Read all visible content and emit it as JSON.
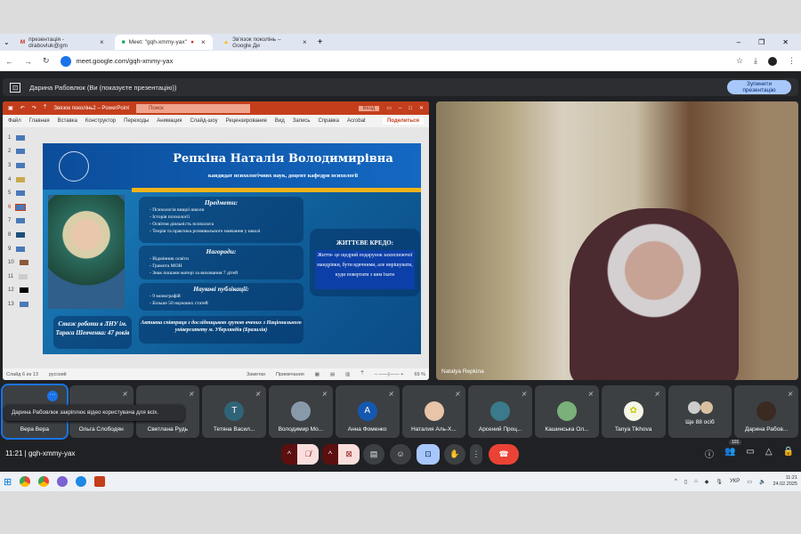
{
  "browser": {
    "tabs": [
      {
        "label": "презентація - drabovluk@gm",
        "icon": "gmail-icon"
      },
      {
        "label": "Meet: \"gqh-xmmy-yax\"",
        "icon": "meet-icon",
        "active": true
      },
      {
        "label": "Зв'язок поколінь – Google Ди",
        "icon": "drive-icon"
      }
    ],
    "new_tab": "+",
    "url": "meet.google.com/gqh-xmmy-yax"
  },
  "presenting": {
    "label": "Дарина Рабовлюк (Ви (показуєте презентацію))",
    "stop_button": "Зупинити презентацію"
  },
  "powerpoint": {
    "title": "Звязок поколінь2 – PowerPoint",
    "search_placeholder": "Поиск",
    "signin": "Вход",
    "menu": [
      "Файл",
      "Главная",
      "Вставка",
      "Конструктор",
      "Переходы",
      "Анимация",
      "Слайд-шоу",
      "Рецензирование",
      "Вид",
      "Запись",
      "Справка",
      "Acrobat"
    ],
    "share": "Поделиться",
    "slides": [
      "1",
      "2",
      "3",
      "4",
      "5",
      "6",
      "7",
      "8",
      "9",
      "10",
      "11",
      "12",
      "13"
    ],
    "selected_slide": 6,
    "status": {
      "slide": "Слайд 6 из 13",
      "language": "русский",
      "notes": "Заметки",
      "comments": "Примечания",
      "zoom": "69 %"
    }
  },
  "slide": {
    "name": "Репкіна Наталія Володимирівна",
    "subtitle": "кандидат психологічних наук, доцент кафедри психології",
    "subjects": {
      "title": "Предмети:",
      "items": [
        "Психологія вищої школи",
        "Історія психології",
        "Освітня діяльність психолога",
        "Теорія та практика розвивального навчання у школі"
      ]
    },
    "awards": {
      "title": "Нагороди:",
      "items": [
        "Відмінник освіти",
        "Грамота МОН",
        "Знак пошани матері за виховання 7 дітей"
      ]
    },
    "publications": {
      "title": "Наукові публікації:",
      "items": [
        "9 монографій",
        "Більше 50 наукових статей"
      ]
    },
    "experience": "Стаж роботи в ЛНУ ім. Тараса Шевченка: 47 років",
    "cooperation": "Активна співпраця з дослідницькою групою вчених з Національного університету м. Уберляндія (Бразилія)",
    "credo_title": "ЖИТТЄВЕ КРЕДО:",
    "credo": "Життя- це щедрий подарунок захоплюючої мандрівки, бути вдячними, але вирішувати, куди повертати з ким їхати"
  },
  "video": {
    "name": "Natalya Repkina"
  },
  "participants": [
    {
      "name": "Вера Вера",
      "pinned": true
    },
    {
      "name": "Ольга Слободян"
    },
    {
      "name": "Светлана Рудь"
    },
    {
      "name": "Тетяна Васил...",
      "initial": "T",
      "color": "#2f6478"
    },
    {
      "name": "Володимир Мо...",
      "color": "#8899aa"
    },
    {
      "name": "Анна Фоменко",
      "initial": "A",
      "color": "#1558b0"
    },
    {
      "name": "Наталия Аль-Х...",
      "color": "#e8c4a8"
    },
    {
      "name": "Арсений Проц...",
      "color": "#3a7a8a"
    },
    {
      "name": "Кашинська Ол...",
      "color": "#7ab07a"
    },
    {
      "name": "Tanya Tikhova",
      "color": "#f5f5e8"
    },
    {
      "name": "Ще 88 осіб"
    },
    {
      "name": "Дарина Рабов...",
      "color": "#3a2a22"
    }
  ],
  "toast": "Дарина Рабовлюк закріплює відео користувача для всіх.",
  "controls": {
    "time": "11:21",
    "meeting_code": "gqh-xmmy-yax",
    "participant_count": "101"
  },
  "taskbar": {
    "lang": "УКР",
    "time": "11:21",
    "date": "24.02.2025"
  }
}
